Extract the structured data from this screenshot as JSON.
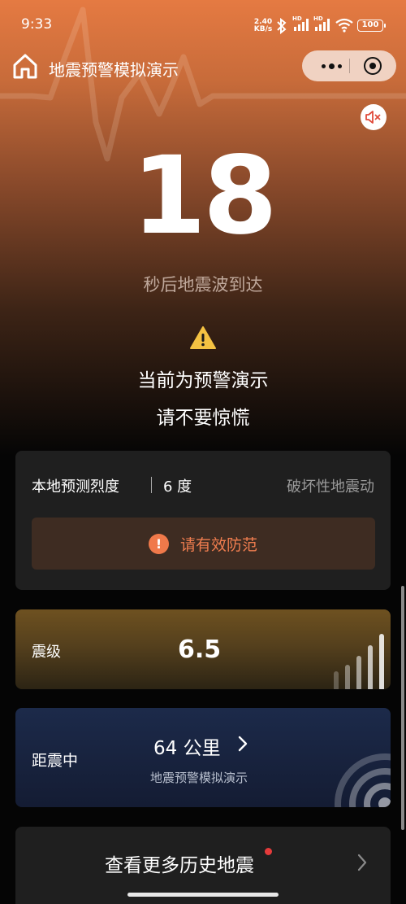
{
  "status_bar": {
    "time": "9:33",
    "net_speed_value": "2.40",
    "net_speed_unit": "KB/s",
    "signal_badge": "HD",
    "battery": "100"
  },
  "nav": {
    "title": "地震预警模拟演示",
    "capsule_bg": "#f0d2c2"
  },
  "countdown": {
    "seconds": "18",
    "subtitle": "秒后地震波到达"
  },
  "notice": {
    "line1": "当前为预警演示",
    "line2": "请不要惊慌"
  },
  "intensity": {
    "label": "本地预测烈度",
    "value": "6 度",
    "description": "破坏性地震动",
    "advice": "请有效防范",
    "advice_icon": "!",
    "accent": "#ef7d4f"
  },
  "magnitude": {
    "label": "震级",
    "value": "6.5"
  },
  "distance": {
    "label": "距震中",
    "value": "64 公里",
    "subtitle": "地震预警模拟演示"
  },
  "history": {
    "label": "查看更多历史地震"
  }
}
